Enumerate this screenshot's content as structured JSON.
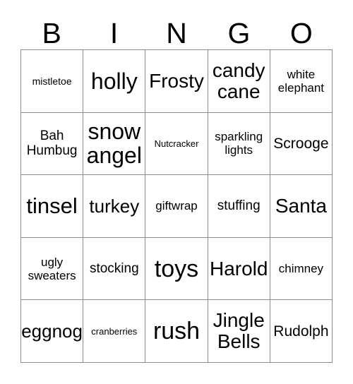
{
  "card": {
    "title": "BINGO Card",
    "header_letters": [
      "B",
      "I",
      "N",
      "G",
      "O"
    ],
    "grid_size": {
      "columns": 5,
      "rows": 5
    },
    "colors": {
      "background": "#ffffff",
      "cell_background": "#ffffff",
      "border": "#8c8c8c",
      "text": "#000000"
    },
    "rows": [
      [
        {
          "label": "mistletoe",
          "size": "sm"
        },
        {
          "label": "holly",
          "size": "6xl"
        },
        {
          "label": "Frosty",
          "size": "4xl"
        },
        {
          "label": "candy cane",
          "size": "4xl"
        },
        {
          "label": "white elephant",
          "size": "md"
        }
      ],
      [
        {
          "label": "Bah Humbug",
          "size": "lg"
        },
        {
          "label": "snow angel",
          "size": "6xl"
        },
        {
          "label": "Nutcracker",
          "size": "xs"
        },
        {
          "label": "sparkling lights",
          "size": "md"
        },
        {
          "label": "Scrooge",
          "size": "xl"
        }
      ],
      [
        {
          "label": "tinsel",
          "size": "5xl"
        },
        {
          "label": "turkey",
          "size": "3xl"
        },
        {
          "label": "giftwrap",
          "size": "md"
        },
        {
          "label": "stuffing",
          "size": "lg"
        },
        {
          "label": "Santa",
          "size": "4xl"
        }
      ],
      [
        {
          "label": "ugly sweaters",
          "size": "md"
        },
        {
          "label": "stocking",
          "size": "lg"
        },
        {
          "label": "toys",
          "size": "7xl"
        },
        {
          "label": "Harold",
          "size": "4xl"
        },
        {
          "label": "chimney",
          "size": "md"
        }
      ],
      [
        {
          "label": "eggnog",
          "size": "3xl"
        },
        {
          "label": "cranberries",
          "size": "xs"
        },
        {
          "label": "rush",
          "size": "7xl"
        },
        {
          "label": "Jingle Bells",
          "size": "4xl"
        },
        {
          "label": "Rudolph",
          "size": "xl"
        }
      ]
    ]
  }
}
